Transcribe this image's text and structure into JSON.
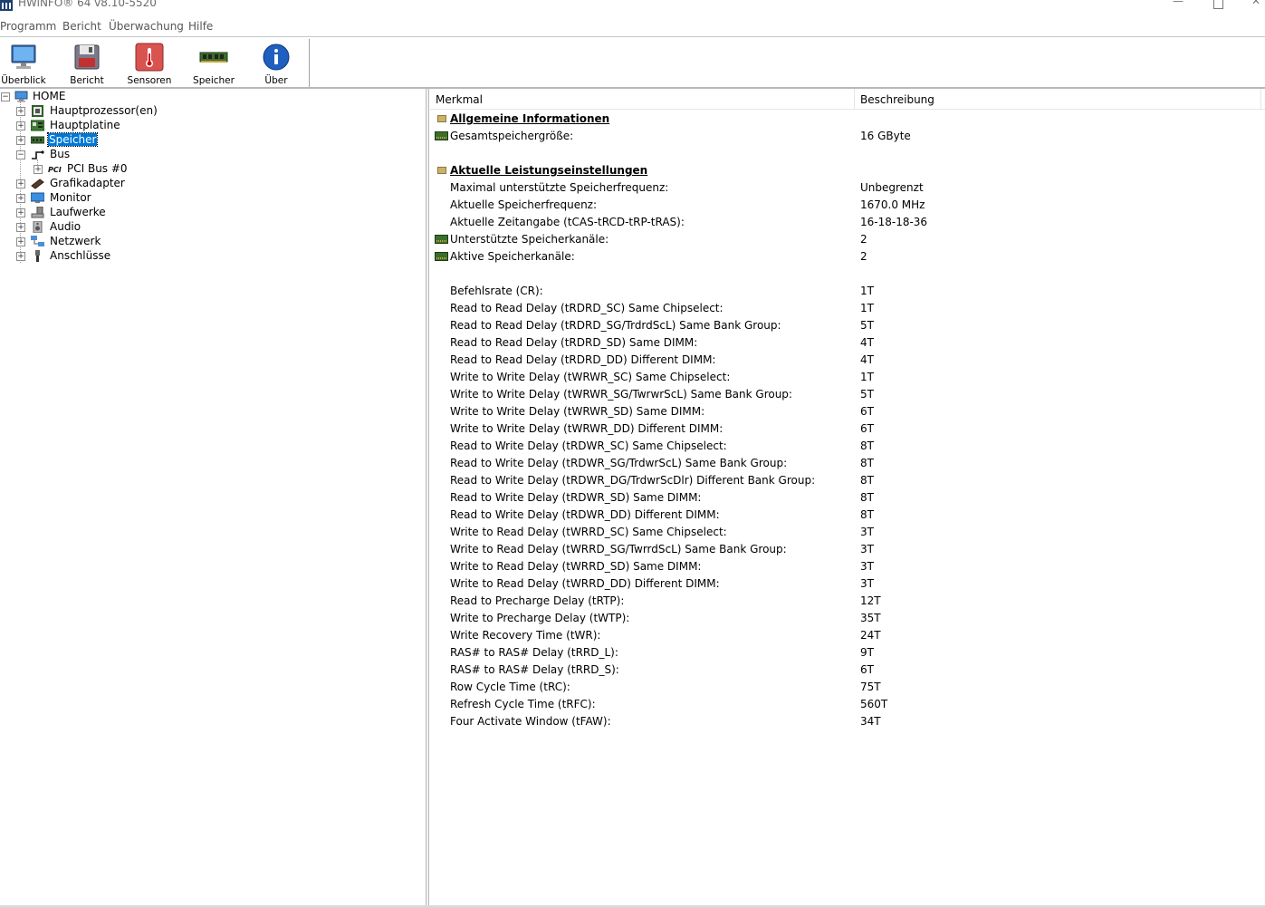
{
  "window": {
    "title": "HWiNFO® 64 v8.10-5520",
    "controls": {
      "minimize": "—",
      "close": "✕"
    }
  },
  "menu": [
    "Programm",
    "Bericht",
    "Überwachung",
    "Hilfe"
  ],
  "toolbar": [
    {
      "label": "Überblick",
      "icon": "monitor-icon"
    },
    {
      "label": "Bericht",
      "icon": "floppy-disk-icon"
    },
    {
      "label": "Sensoren",
      "icon": "thermometer-icon"
    },
    {
      "label": "Speicher",
      "icon": "memory-module-icon"
    },
    {
      "label": "Über",
      "icon": "info-icon"
    }
  ],
  "tree": {
    "root": "HOME",
    "items": [
      {
        "label": "Hauptprozessor(en)",
        "icon": "cpu-icon",
        "expander": "+"
      },
      {
        "label": "Hauptplatine",
        "icon": "motherboard-icon",
        "expander": "+"
      },
      {
        "label": "Speicher",
        "icon": "memory-icon",
        "expander": "+",
        "selected": true
      },
      {
        "label": "Bus",
        "icon": "bus-icon",
        "expander": "−"
      },
      {
        "label": "PCI Bus #0",
        "icon": "pci-icon",
        "expander": "+"
      },
      {
        "label": "Grafikadapter",
        "icon": "graphics-card-icon",
        "expander": "+"
      },
      {
        "label": "Monitor",
        "icon": "monitor-icon",
        "expander": "+"
      },
      {
        "label": "Laufwerke",
        "icon": "drive-icon",
        "expander": "+"
      },
      {
        "label": "Audio",
        "icon": "speaker-icon",
        "expander": "+"
      },
      {
        "label": "Netzwerk",
        "icon": "network-icon",
        "expander": "+"
      },
      {
        "label": "Anschlüsse",
        "icon": "usb-plug-icon",
        "expander": "+"
      }
    ],
    "root_expander": "−"
  },
  "list": {
    "columns": [
      "Merkmal",
      "Beschreibung"
    ],
    "rows": [
      {
        "feature": "Allgemeine Informationen",
        "value": "",
        "type": "section"
      },
      {
        "feature": "Gesamtspeichergröße:",
        "value": "16 GByte",
        "type": "ram"
      },
      {
        "feature": "",
        "value": "",
        "type": "blank"
      },
      {
        "feature": "Aktuelle Leistungseinstellungen",
        "value": "",
        "type": "section"
      },
      {
        "feature": "Maximal unterstützte Speicherfrequenz:",
        "value": "Unbegrenzt",
        "type": "plain"
      },
      {
        "feature": "Aktuelle Speicherfrequenz:",
        "value": "1670.0 MHz",
        "type": "plain"
      },
      {
        "feature": "Aktuelle Zeitangabe (tCAS-tRCD-tRP-tRAS):",
        "value": "16-18-18-36",
        "type": "plain"
      },
      {
        "feature": "Unterstützte Speicherkanäle:",
        "value": "2",
        "type": "ram"
      },
      {
        "feature": "Aktive Speicherkanäle:",
        "value": "2",
        "type": "ram"
      },
      {
        "feature": "",
        "value": "",
        "type": "blank"
      },
      {
        "feature": "Befehlsrate (CR):",
        "value": "1T",
        "type": "plain"
      },
      {
        "feature": "Read to Read Delay (tRDRD_SC) Same Chipselect:",
        "value": "1T",
        "type": "plain"
      },
      {
        "feature": "Read to Read Delay (tRDRD_SG/TrdrdScL) Same Bank Group:",
        "value": "5T",
        "type": "plain"
      },
      {
        "feature": "Read to Read Delay (tRDRD_SD) Same DIMM:",
        "value": "4T",
        "type": "plain"
      },
      {
        "feature": "Read to Read Delay (tRDRD_DD) Different DIMM:",
        "value": "4T",
        "type": "plain"
      },
      {
        "feature": "Write to Write Delay (tWRWR_SC) Same Chipselect:",
        "value": "1T",
        "type": "plain"
      },
      {
        "feature": "Write to Write Delay (tWRWR_SG/TwrwrScL) Same Bank Group:",
        "value": "5T",
        "type": "plain"
      },
      {
        "feature": "Write to Write Delay (tWRWR_SD) Same DIMM:",
        "value": "6T",
        "type": "plain"
      },
      {
        "feature": "Write to Write Delay (tWRWR_DD) Different DIMM:",
        "value": "6T",
        "type": "plain"
      },
      {
        "feature": "Read to Write Delay (tRDWR_SC) Same Chipselect:",
        "value": "8T",
        "type": "plain"
      },
      {
        "feature": "Read to Write Delay (tRDWR_SG/TrdwrScL) Same Bank Group:",
        "value": "8T",
        "type": "plain"
      },
      {
        "feature": "Read to Write Delay (tRDWR_DG/TrdwrScDlr) Different Bank Group:",
        "value": "8T",
        "type": "plain"
      },
      {
        "feature": "Read to Write Delay (tRDWR_SD) Same DIMM:",
        "value": "8T",
        "type": "plain"
      },
      {
        "feature": "Read to Write Delay (tRDWR_DD) Different DIMM:",
        "value": "8T",
        "type": "plain"
      },
      {
        "feature": "Write to Read Delay (tWRRD_SC) Same Chipselect:",
        "value": "3T",
        "type": "plain"
      },
      {
        "feature": "Write to Read Delay (tWRRD_SG/TwrrdScL) Same Bank Group:",
        "value": "3T",
        "type": "plain"
      },
      {
        "feature": "Write to Read Delay (tWRRD_SD) Same DIMM:",
        "value": "3T",
        "type": "plain"
      },
      {
        "feature": "Write to Read Delay (tWRRD_DD) Different DIMM:",
        "value": "3T",
        "type": "plain"
      },
      {
        "feature": "Read to Precharge Delay (tRTP):",
        "value": "12T",
        "type": "plain"
      },
      {
        "feature": "Write to Precharge Delay (tWTP):",
        "value": "35T",
        "type": "plain"
      },
      {
        "feature": "Write Recovery Time (tWR):",
        "value": "24T",
        "type": "plain"
      },
      {
        "feature": "RAS# to RAS# Delay (tRRD_L):",
        "value": "9T",
        "type": "plain"
      },
      {
        "feature": "RAS# to RAS# Delay (tRRD_S):",
        "value": "6T",
        "type": "plain"
      },
      {
        "feature": "Row Cycle Time (tRC):",
        "value": "75T",
        "type": "plain"
      },
      {
        "feature": "Refresh Cycle Time (tRFC):",
        "value": "560T",
        "type": "plain"
      },
      {
        "feature": "Four Activate Window (tFAW):",
        "value": "34T",
        "type": "plain"
      }
    ]
  }
}
